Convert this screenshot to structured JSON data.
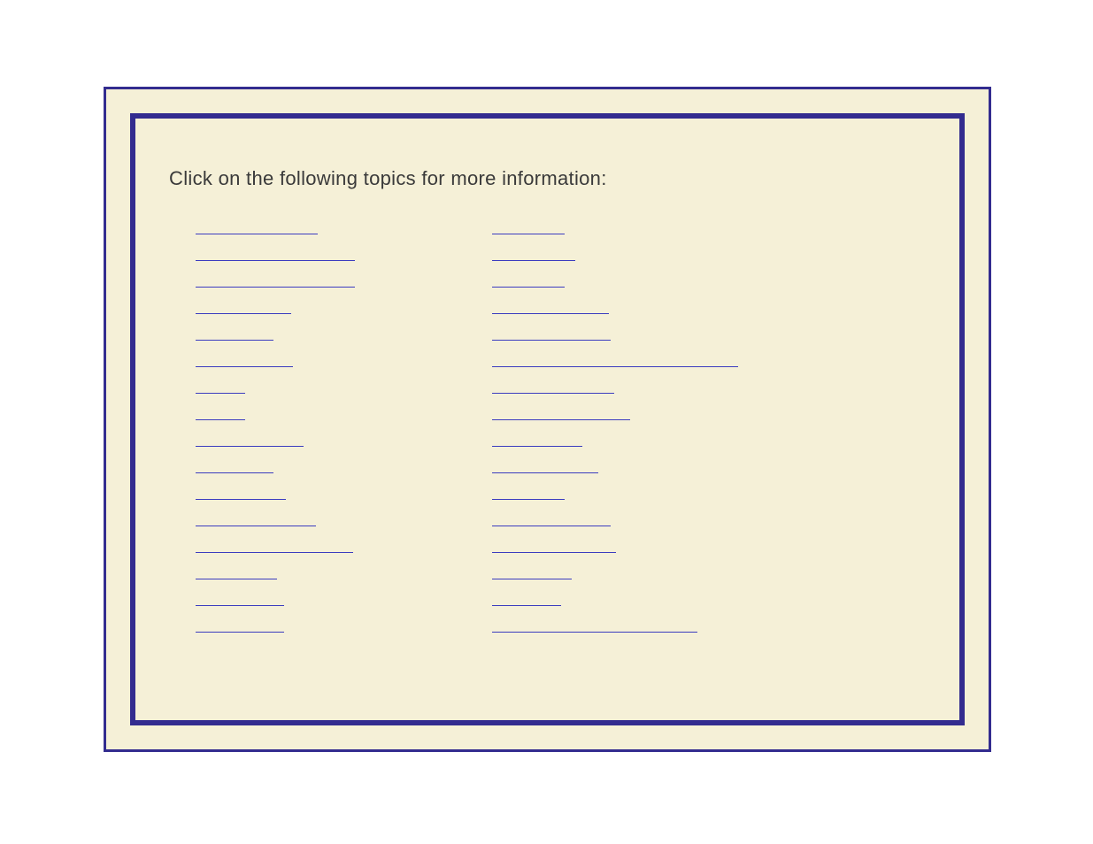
{
  "instruction": "Click on the following topics for more information:",
  "leftLinks": [
    {
      "widthPx": 138
    },
    {
      "widthPx": 180
    },
    {
      "widthPx": 180
    },
    {
      "widthPx": 108
    },
    {
      "widthPx": 88
    },
    {
      "widthPx": 110
    },
    {
      "widthPx": 56
    },
    {
      "widthPx": 56
    },
    {
      "widthPx": 122
    },
    {
      "widthPx": 88
    },
    {
      "widthPx": 102
    },
    {
      "widthPx": 136
    },
    {
      "widthPx": 178
    },
    {
      "widthPx": 92
    },
    {
      "widthPx": 100
    },
    {
      "widthPx": 100
    }
  ],
  "rightLinks": [
    {
      "widthPx": 82
    },
    {
      "widthPx": 94
    },
    {
      "widthPx": 82
    },
    {
      "widthPx": 132
    },
    {
      "widthPx": 134
    },
    {
      "widthPx": 278
    },
    {
      "widthPx": 138
    },
    {
      "widthPx": 156
    },
    {
      "widthPx": 102
    },
    {
      "widthPx": 120
    },
    {
      "widthPx": 82
    },
    {
      "widthPx": 134
    },
    {
      "widthPx": 140
    },
    {
      "widthPx": 90
    },
    {
      "widthPx": 78
    },
    {
      "widthPx": 232
    }
  ]
}
